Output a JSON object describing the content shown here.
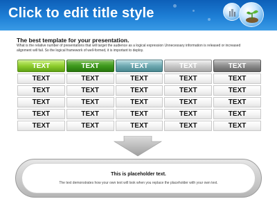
{
  "header": {
    "title": "Click to edit title style"
  },
  "content": {
    "subtitle": "The best template for your presentation.",
    "description": "What is the relative number of presentations that will target the audience as a logical expression Unnecessary information is released or increased alignment will fail. So the logical framework of well-formed, it is important to deploy."
  },
  "table": {
    "headers": [
      "TEXT",
      "TEXT",
      "TEXT",
      "TEXT",
      "TEXT"
    ],
    "header_colors": [
      "#8fcd2e",
      "#3e9a1d",
      "#6fa9b1",
      "#c9c9c9",
      "#8c8c8c"
    ],
    "rows": [
      [
        "TEXT",
        "TEXT",
        "TEXT",
        "TEXT",
        "TEXT"
      ],
      [
        "TEXT",
        "TEXT",
        "TEXT",
        "TEXT",
        "TEXT"
      ],
      [
        "TEXT",
        "TEXT",
        "TEXT",
        "TEXT",
        "TEXT"
      ],
      [
        "TEXT",
        "TEXT",
        "TEXT",
        "TEXT",
        "TEXT"
      ],
      [
        "TEXT",
        "TEXT",
        "TEXT",
        "TEXT",
        "TEXT"
      ]
    ]
  },
  "placeholder": {
    "title": "This is placeholder text.",
    "text": "The text demonstrates how your own text will look when you replace the placeholder with your own text."
  },
  "colors": {
    "header_bg": "#1e7fd6",
    "arrow": "#b5b5b5"
  },
  "icons": [
    "globe-bubble-icon",
    "plant-bubble-icon"
  ]
}
